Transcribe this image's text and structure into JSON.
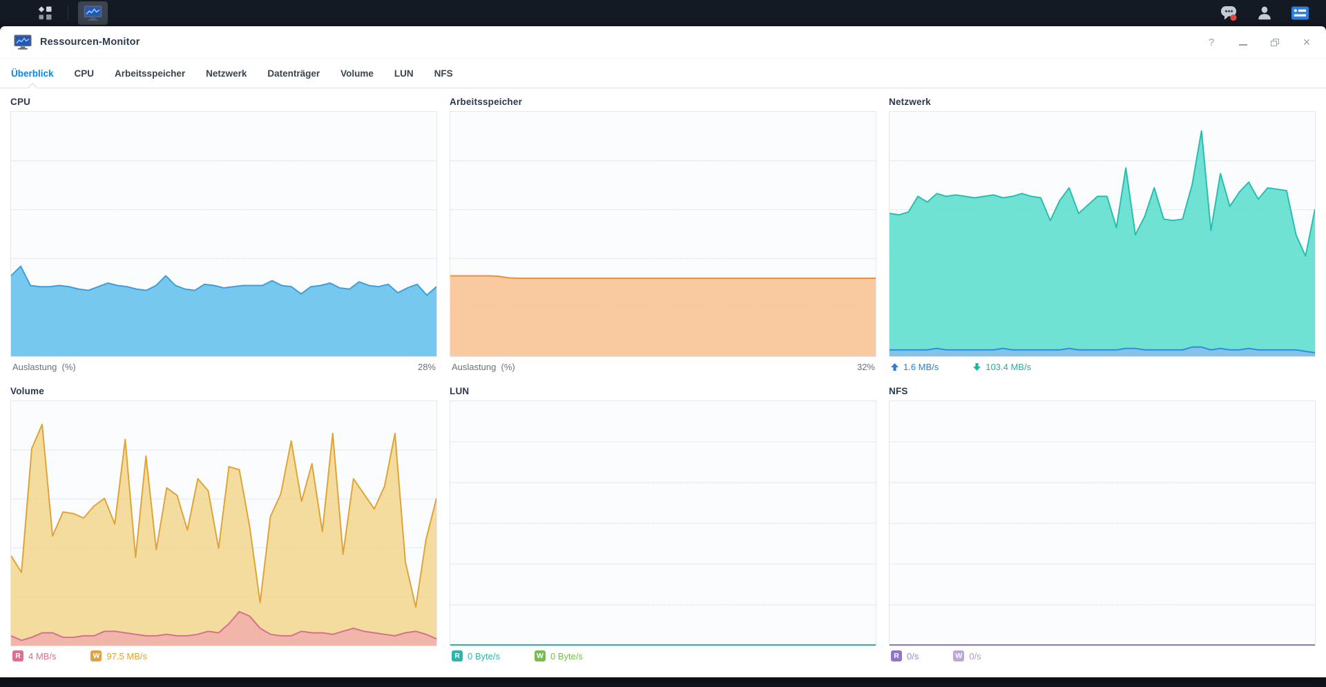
{
  "taskbar": {
    "left_icons": [
      "app-grid-icon",
      "resource-monitor-icon"
    ],
    "open_app": "Ressourcen-Monitor",
    "right_icons": [
      "chat-icon",
      "user-icon",
      "widgets-icon"
    ],
    "chat_has_notification": true,
    "colors": {
      "bar_bg": "#141a23",
      "icon_gray": "#c6ccd6",
      "notification_red": "#e8453f",
      "widgets_blue": "#2e7fe2",
      "active_app_bg": "#3a434f"
    }
  },
  "window": {
    "title": "Ressourcen-Monitor",
    "controls": {
      "help": "?",
      "close": "×"
    },
    "accent_blue": "#0c85e8"
  },
  "tabs": [
    {
      "label": "Überblick",
      "active": true
    },
    {
      "label": "CPU",
      "active": false
    },
    {
      "label": "Arbeitsspeicher",
      "active": false
    },
    {
      "label": "Netzwerk",
      "active": false
    },
    {
      "label": "Datenträger",
      "active": false
    },
    {
      "label": "Volume",
      "active": false
    },
    {
      "label": "LUN",
      "active": false
    },
    {
      "label": "NFS",
      "active": false
    }
  ],
  "panels": [
    {
      "id": "cpu",
      "title": "CPU",
      "legend": [
        {
          "name": "auslastung",
          "type": "label",
          "text": "Auslastung  (%)",
          "color": "#66727e"
        }
      ],
      "right_value": {
        "text": "28%",
        "color": "#66727e"
      },
      "chart": {
        "type": "area",
        "ylim": [
          0,
          100
        ],
        "gridlines": 4,
        "series": [
          {
            "name": "Auslastung",
            "stroke": "#3f9ed6",
            "fill": "#77c8ee",
            "values": [
              33,
              37,
              29,
              28.5,
              28.5,
              29,
              28.5,
              27.5,
              27,
              28.5,
              30,
              29,
              28.5,
              27.5,
              27,
              29,
              33,
              29,
              27.5,
              27,
              29.5,
              29,
              28,
              28.5,
              29,
              29,
              29,
              31,
              29,
              28.5,
              25.5,
              28.5,
              29,
              30,
              28,
              27.5,
              30.5,
              29,
              28.5,
              29.5,
              26,
              28,
              29.5,
              25,
              28.5
            ]
          }
        ]
      }
    },
    {
      "id": "arbeitsspeicher",
      "title": "Arbeitsspeicher",
      "legend": [
        {
          "name": "auslastung",
          "type": "label",
          "text": "Auslastung  (%)",
          "color": "#66727e"
        }
      ],
      "right_value": {
        "text": "32%",
        "color": "#66727e"
      },
      "chart": {
        "type": "area",
        "ylim": [
          0,
          100
        ],
        "gridlines": 4,
        "series": [
          {
            "name": "Auslastung",
            "stroke": "#e6933c",
            "fill": "#f9c9a0",
            "values": [
              33,
              33,
              33,
              33,
              33,
              32.8,
              32.2,
              32,
              32,
              32,
              32,
              32,
              32,
              32,
              32,
              32,
              32,
              32,
              32,
              32,
              32,
              32,
              32,
              32,
              32,
              32,
              32,
              32,
              32,
              32,
              32,
              32,
              32,
              32,
              32,
              32,
              32,
              32,
              32,
              32,
              32,
              32,
              32,
              32,
              32
            ]
          }
        ]
      }
    },
    {
      "id": "netzwerk",
      "title": "Netzwerk",
      "legend": [
        {
          "name": "gesendet",
          "type": "arrow-up",
          "icon": "upload-arrow-icon",
          "text": "1.6 MB/s",
          "color": "#2a7fd4"
        },
        {
          "name": "empfangen",
          "type": "arrow-down",
          "icon": "download-arrow-icon",
          "text": "103.4 MB/s",
          "color": "#14b9a2"
        }
      ],
      "chart": {
        "type": "area",
        "ylim": [
          0,
          170
        ],
        "unit": "MB/s",
        "gridlines": 4,
        "series": [
          {
            "name": "Empfangen",
            "stroke": "#27beb1",
            "fill": "#70e2d4",
            "values": [
              100,
              99,
              101,
              112,
              108,
              114,
              112,
              113,
              112,
              111,
              112,
              113,
              111,
              112,
              114,
              112,
              111,
              95,
              109,
              118,
              100,
              106,
              112,
              112,
              90,
              132,
              85,
              98,
              118,
              96,
              95,
              96,
              120,
              158,
              88,
              128,
              105,
              115,
              122,
              110,
              118,
              117,
              116,
              85,
              70,
              103
            ]
          },
          {
            "name": "Gesendet",
            "stroke": "#2d8ddb",
            "fill": "#85c3ea",
            "values": [
              4,
              4,
              4,
              4,
              4,
              5,
              4,
              4,
              4,
              4,
              4,
              4,
              5,
              4,
              4,
              4,
              4,
              4,
              4,
              5,
              4,
              4,
              4,
              4,
              4,
              5,
              5,
              4,
              4,
              4,
              4,
              4,
              6,
              6,
              4,
              5,
              4,
              4,
              5,
              4,
              4,
              4,
              4,
              4,
              3,
              2
            ]
          }
        ]
      }
    },
    {
      "id": "volume",
      "title": "Volume",
      "legend": [
        {
          "name": "lesen",
          "type": "badge",
          "icon": "read-badge",
          "badge": "R",
          "badge_color": "#dc6f8e",
          "text": "4 MB/s",
          "color": "#d5708f"
        },
        {
          "name": "schreiben",
          "type": "badge",
          "icon": "write-badge",
          "badge": "W",
          "badge_color": "#e2a23b",
          "text": "97.5 MB/s",
          "color": "#dfa22f"
        }
      ],
      "chart": {
        "type": "area",
        "ylim": [
          0,
          160
        ],
        "unit": "MB/s",
        "gridlines": 4,
        "series": [
          {
            "name": "Schreiben",
            "stroke": "#dfa434",
            "fill": "#f3dc9e",
            "values": [
              59,
              48,
              130,
              146,
              72,
              88,
              87,
              84,
              92,
              97,
              80,
              136,
              58,
              125,
              63,
              104,
              99,
              76,
              110,
              102,
              64,
              118,
              116,
              78,
              28,
              85,
              100,
              135,
              95,
              120,
              75,
              140,
              60,
              110,
              100,
              90,
              105,
              140,
              55,
              25,
              70,
              97
            ]
          },
          {
            "name": "Lesen",
            "stroke": "#d4708e",
            "fill": "#f2b5a9",
            "values": [
              6,
              3,
              5,
              8,
              8,
              5,
              5,
              6,
              6,
              9,
              9,
              8,
              7,
              6,
              6,
              7,
              6,
              6,
              7,
              9,
              8,
              14,
              22,
              19,
              11,
              7,
              6,
              6,
              9,
              8,
              8,
              7,
              9,
              11,
              9,
              8,
              7,
              6,
              8,
              9,
              7,
              4
            ]
          }
        ]
      }
    },
    {
      "id": "lun",
      "title": "LUN",
      "legend": [
        {
          "name": "lesen",
          "type": "badge",
          "icon": "read-badge",
          "badge": "R",
          "badge_color": "#2cb6ac",
          "text": "0 Byte/s",
          "color": "#2cb6ac"
        },
        {
          "name": "schreiben",
          "type": "badge",
          "icon": "write-badge",
          "badge": "W",
          "badge_color": "#76bf4a",
          "text": "0 Byte/s",
          "color": "#76bf4a"
        }
      ],
      "chart": {
        "type": "area",
        "ylim": [
          0,
          1
        ],
        "gridlines": 5,
        "series": [
          {
            "name": "Schreiben",
            "stroke": "#79c04c",
            "fill": null,
            "values": [
              0,
              0
            ]
          },
          {
            "name": "Lesen",
            "stroke": "#2bb7ab",
            "fill": null,
            "values": [
              0,
              0
            ]
          }
        ]
      }
    },
    {
      "id": "nfs",
      "title": "NFS",
      "legend": [
        {
          "name": "lesen",
          "type": "badge",
          "icon": "read-badge",
          "badge": "R",
          "badge_color": "#8f74c9",
          "text": "0/s",
          "color": "#9d86c9"
        },
        {
          "name": "schreiben",
          "type": "badge",
          "icon": "write-badge",
          "badge": "W",
          "badge_color": "#bca6de",
          "text": "0/s",
          "color": "#a79ac0"
        }
      ],
      "chart": {
        "type": "area",
        "ylim": [
          0,
          1
        ],
        "gridlines": 5,
        "series": [
          {
            "name": "Schreiben",
            "stroke": "#bda7df",
            "fill": null,
            "values": [
              0,
              0
            ]
          },
          {
            "name": "Lesen",
            "stroke": "#9379cc",
            "fill": null,
            "values": [
              0,
              0
            ]
          }
        ]
      }
    }
  ]
}
